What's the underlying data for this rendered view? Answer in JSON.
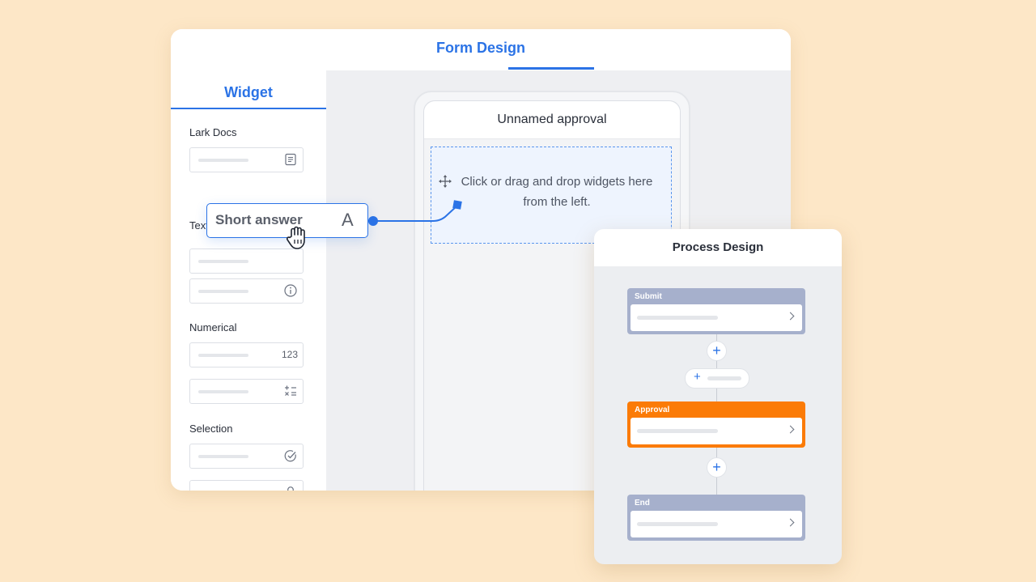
{
  "form_design": {
    "title": "Form Design"
  },
  "widget_panel": {
    "title": "Widget",
    "sections": [
      {
        "label": "Lark Docs"
      },
      {
        "label": "Text"
      },
      {
        "label": "Numerical",
        "field_text": "123"
      },
      {
        "label": "Selection"
      }
    ]
  },
  "phone": {
    "title": "Unnamed approval",
    "drop_hint": "Click or drag and drop widgets here from the left."
  },
  "dragged_widget": {
    "label": "Short answer",
    "icon_letter": "A"
  },
  "process_design": {
    "title": "Process Design",
    "nodes": [
      {
        "label": "Submit",
        "color": "#a6b0cc"
      },
      {
        "label": "Approval",
        "color": "#fb7b07"
      },
      {
        "label": "End",
        "color": "#a6b0cc"
      }
    ],
    "add_symbol": "+"
  },
  "colors": {
    "accent": "#2b73e6",
    "background": "#fde7c7"
  }
}
